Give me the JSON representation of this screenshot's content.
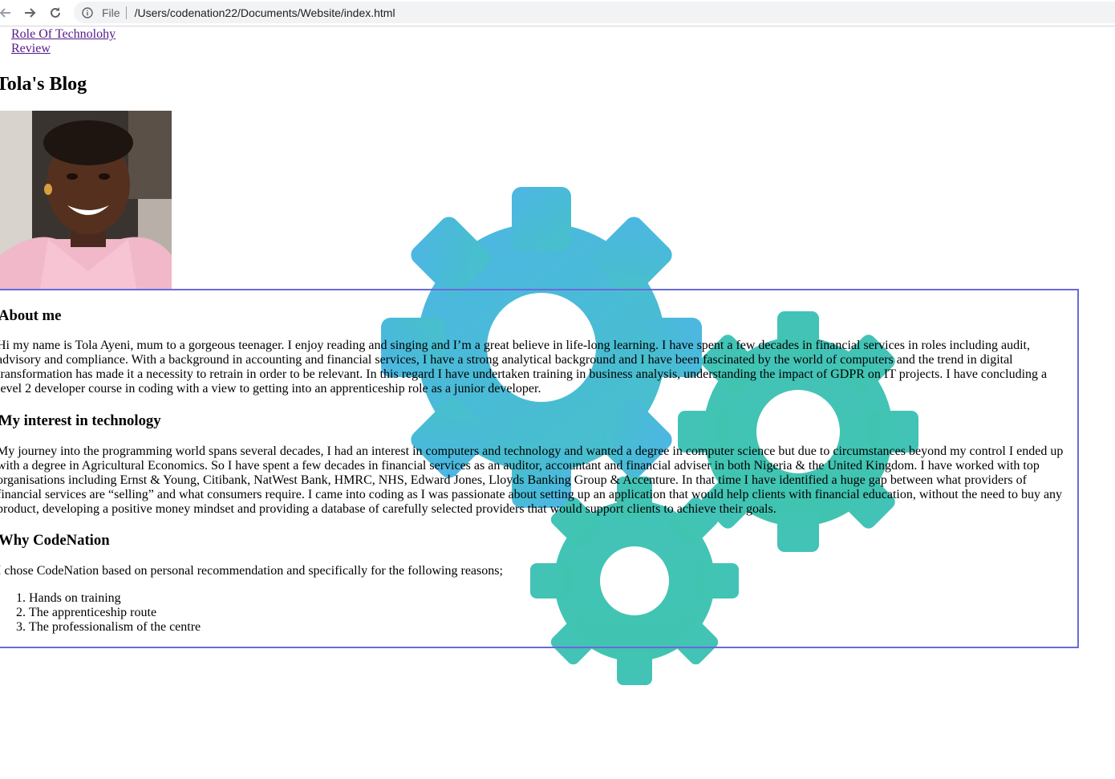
{
  "browser": {
    "scheme": "File",
    "url": "/Users/codenation22/Documents/Website/index.html"
  },
  "nav": {
    "links": [
      "Role Of Technolohy",
      "Review"
    ]
  },
  "blog_title": "Tola's Blog",
  "sections": {
    "about": {
      "heading": "About me",
      "body": "Hi my name is Tola Ayeni, mum to a gorgeous teenager. I enjoy reading and singing and I’m a great believe in life-long learning. I have spent a few decades in financial services in roles including audit, advisory and compliance. With a background in accounting and financial services, I have a strong analytical background and I have been fascinated by the world of computers and the trend in digital transformation has made it a necessity to retrain in order to be relevant. In this regard I have undertaken training in business analysis, understanding the impact of GDPR on IT projects. I have concluding a level 2 developer course in coding with a view to getting into an apprenticeship role as a junior developer."
    },
    "interest": {
      "heading": "My interest in technology",
      "body": "My journey into the programming world spans several decades, I had an interest in computers and technology and wanted a degree in computer science but due to circumstances beyond my control I ended up with a degree in Agricultural Economics. So I have spent a few decades in financial services as an auditor, accountant and financial adviser in both Nigeria & the United Kingdom. I have worked with top organisations including Ernst & Young, Citibank, NatWest Bank, HMRC, NHS, Edward Jones, Lloyds Banking Group & Accenture. In that time I have identified a huge gap between what providers of financial services are “selling” and what consumers require. I came into coding as I was passionate about setting up an application that would help clients with financial education, without the need to buy any product, developing a positive money mindset and providing a database of carefully selected providers that would support clients to achieve their goals."
    },
    "why": {
      "heading": "Why CodeNation",
      "body": "I chose CodeNation based on personal recommendation and specifically for the following reasons;",
      "reasons": [
        "Hands on training",
        "The apprenticeship route",
        "The professionalism of the centre"
      ]
    }
  },
  "colors": {
    "gear_blue": "#4db6e4",
    "gear_teal": "#40c4b0",
    "box_border": "#6a6ad8",
    "link": "#551a8b"
  },
  "icons": [
    "back-arrow-icon",
    "forward-arrow-icon",
    "reload-icon",
    "info-icon",
    "gears-icon"
  ]
}
